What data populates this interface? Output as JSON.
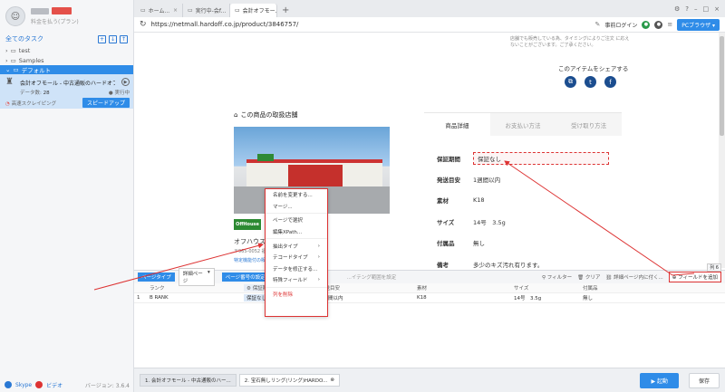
{
  "sidebar": {
    "user_sub": "料金を払う(プラン)",
    "all_tasks": "全てのタスク",
    "tree": [
      {
        "label": "test"
      },
      {
        "label": "Samples"
      },
      {
        "label": "デフォルト"
      }
    ],
    "task": {
      "title": "会計オフモール - 中古通販のハードオフ公式...",
      "data_label": "データ数:",
      "data_count": "28",
      "status": "実行中",
      "mode": "高速スクレイピング",
      "speed_button": "スピードアップ"
    },
    "footer": {
      "skype": "Skype",
      "video": "ビデオ",
      "version": "バージョン: 3.6.4"
    }
  },
  "browser": {
    "tabs": [
      {
        "label": "ホーム..."
      },
      {
        "label": "実行中-会f..."
      },
      {
        "label": "会計オフモー..."
      }
    ],
    "login": "事前ログイン",
    "pc_browser": "PCブラウザ",
    "url": "https://netmall.hardoff.co.jp/product/3846757/"
  },
  "page": {
    "note": "店舗でも販売している為、タイミングによりご注文 に応えないことがございます。ご了承ください。",
    "share_title": "このアイテムをシェアする",
    "shop_title": "この商品の取扱店舗",
    "shop_name": "オフハウス",
    "shop_addr": "〒965-0052 福島県...",
    "shop_link": "特定機能付の販売ページ",
    "detail_tabs": [
      "商品詳細",
      "お支払い方法",
      "受け取り方法"
    ],
    "details": [
      {
        "k": "保証期間",
        "v": "保証なし"
      },
      {
        "k": "発送目安",
        "v": "1週間以内"
      },
      {
        "k": "素材",
        "v": "K18"
      },
      {
        "k": "サイズ",
        "v": "14号　3.5g"
      },
      {
        "k": "付属品",
        "v": "無し"
      },
      {
        "k": "備考",
        "v": "多少のキズ汚れ有ります。"
      }
    ]
  },
  "context_menu": {
    "items": [
      "名前を変更する...",
      "マージ...",
      "ページで選択",
      "編集XPath...",
      "抽出タイプ",
      "テコードタイプ",
      "データを修正する...",
      "特殊フィールド",
      "列を削除"
    ]
  },
  "panel": {
    "page_type": "ページタイプ",
    "page_type_val": "詳細ページ",
    "page_num": "ページ番号の設定",
    "hint": "...イテング範囲を設定",
    "filter": "フィルター",
    "clear": "クリア",
    "detail_page": "詳細ページ内に付く...",
    "add_field": "フィールドを追加",
    "col_tag": "列 6",
    "columns": [
      "ランク",
      "保証期間",
      "発送目安",
      "素材",
      "サイズ",
      "付属品"
    ],
    "rows": [
      [
        "1",
        "B RANK",
        "保証なし",
        "1週間以内",
        "K18",
        "14号　3.5g",
        "無し"
      ]
    ]
  },
  "bottom": {
    "tabs": [
      "1. 会計オフモール - 中古通販のハー...",
      "2. 宝石無しリング(リング)HARDO..."
    ],
    "run": "▶ 起動",
    "save": "保存"
  },
  "colors": {
    "accent": "#2f8ce8",
    "highlight": "#dd3333"
  }
}
